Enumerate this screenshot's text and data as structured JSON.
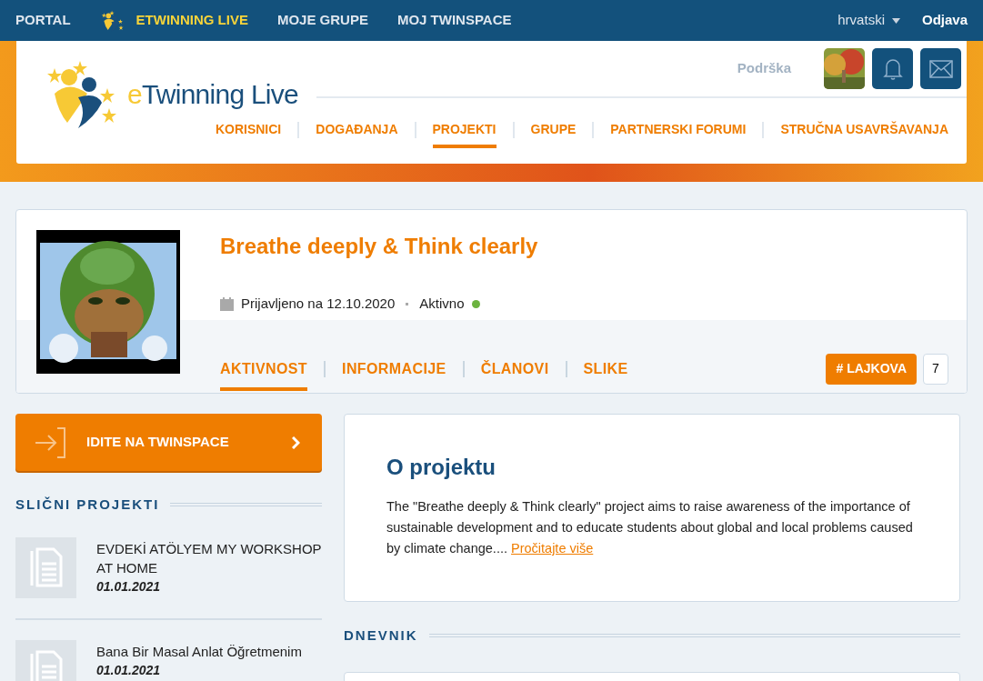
{
  "top_bar": {
    "links": [
      {
        "label": "PORTAL",
        "selected": false,
        "kind": "plain"
      },
      {
        "label": "ETWINNING LIVE",
        "selected": true,
        "kind": "logo"
      },
      {
        "label": "MOJE GRUPE",
        "selected": false,
        "kind": "plain"
      },
      {
        "label": "MOJ TWINSPACE",
        "selected": false,
        "kind": "plain"
      }
    ],
    "language": "hrvatski",
    "logout": "Odjava"
  },
  "header": {
    "logo": {
      "prefix": "e",
      "name": "Twinning",
      "suffix": "Live"
    },
    "support": "Podrška",
    "nav": [
      {
        "label": "KORISNICI",
        "selected": false
      },
      {
        "label": "DOGAĐANJA",
        "selected": false
      },
      {
        "label": "PROJEKTI",
        "selected": true
      },
      {
        "label": "GRUPE",
        "selected": false
      },
      {
        "label": "PARTNERSKI FORUMI",
        "selected": false
      },
      {
        "label": "STRUČNA USAVRŠAVANJA",
        "selected": false
      }
    ]
  },
  "project": {
    "title": "Breathe deeply & Think clearly",
    "registered": "Prijavljeno na 12.10.2020",
    "status": {
      "label": "Aktivno",
      "color": "#6cb33f"
    },
    "tabs": [
      {
        "label": "AKTIVNOST",
        "selected": true
      },
      {
        "label": "INFORMACIJE",
        "selected": false
      },
      {
        "label": "ČLANOVI",
        "selected": false
      },
      {
        "label": "SLIKE",
        "selected": false
      }
    ],
    "likes_button": "# LAJKOVA",
    "likes_count": "7"
  },
  "twinspace_button": "IDITE NA TWINSPACE",
  "similar": {
    "heading": "SLIČNI PROJEKTI",
    "items": [
      {
        "title": "EVDEKİ ATÖLYEM MY WORKSHOP AT HOME",
        "date": "01.01.2021"
      },
      {
        "title": "Bana Bir Masal Anlat Öğretmenim",
        "date": "01.01.2021"
      }
    ]
  },
  "about": {
    "heading": "O projektu",
    "text": "The \"Breathe deeply & Think clearly\" project aims to raise awareness of the importance of sustainable development and to educate students about global and local problems caused by climate change.... ",
    "link": "Pročitajte više"
  },
  "diary": {
    "heading": "DNEVNIK"
  }
}
